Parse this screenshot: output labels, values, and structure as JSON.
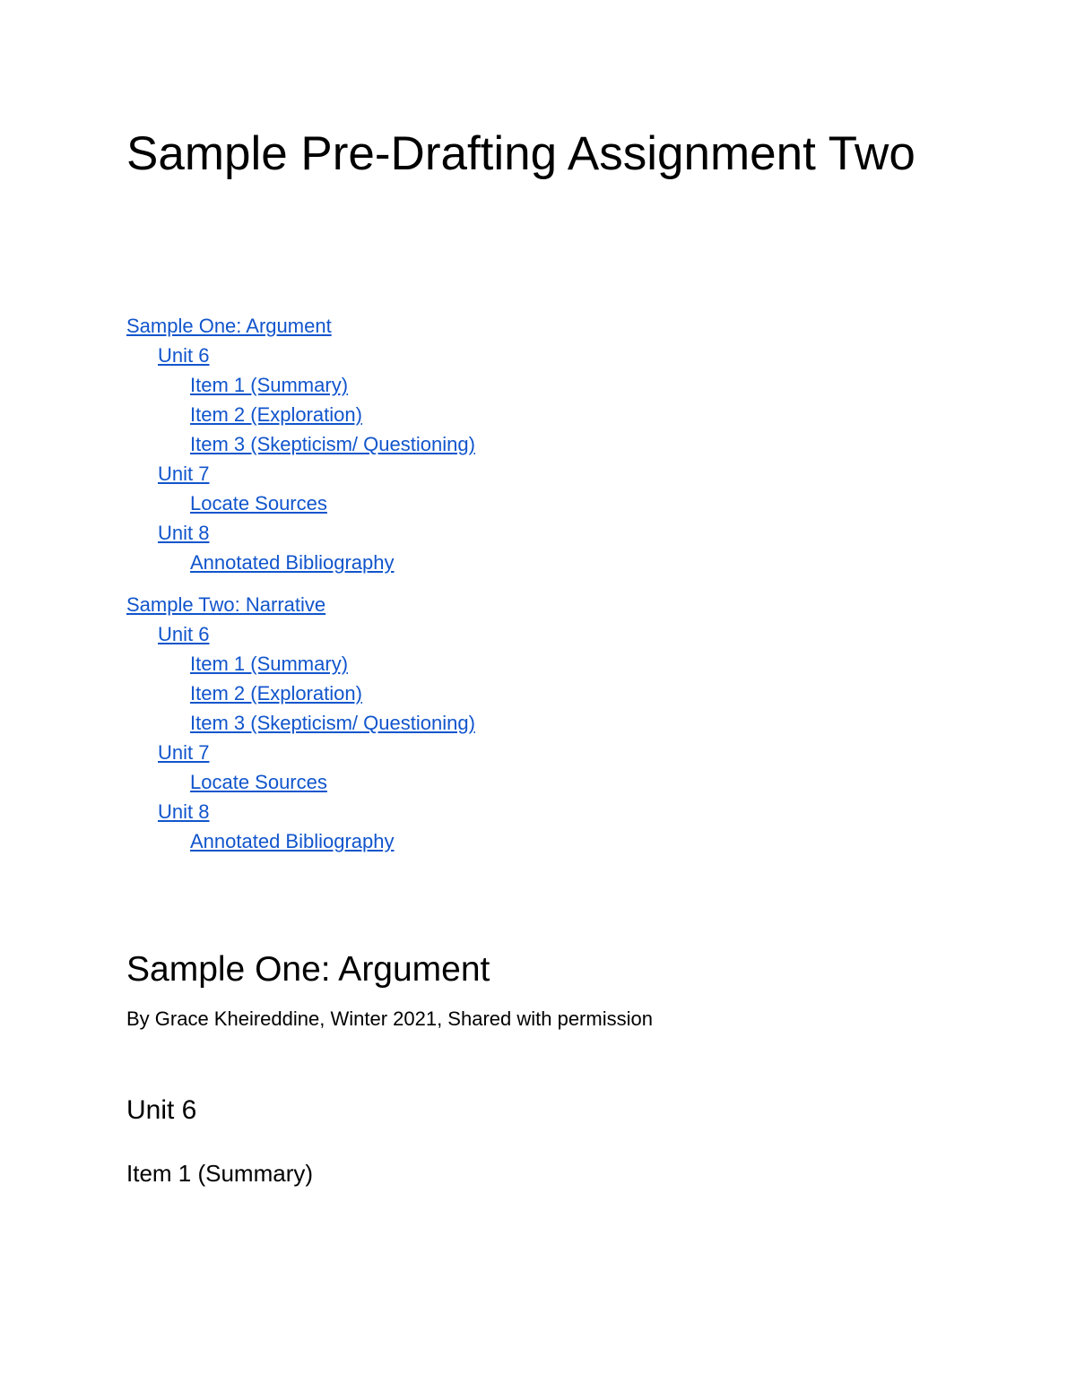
{
  "document": {
    "title": "Sample Pre-Drafting Assignment Two",
    "link_color": "#1155cc"
  },
  "toc": {
    "groups": [
      {
        "label": "Sample One: Argument",
        "units": [
          {
            "label": "Unit 6",
            "items": [
              "Item 1 (Summary)",
              "Item 2 (Exploration)",
              "Item 3 (Skepticism/ Questioning)"
            ]
          },
          {
            "label": "Unit 7",
            "items": [
              "Locate Sources"
            ]
          },
          {
            "label": "Unit 8",
            "items": [
              "Annotated Bibliography"
            ]
          }
        ]
      },
      {
        "label": "Sample Two: Narrative",
        "units": [
          {
            "label": "Unit 6",
            "items": [
              "Item 1 (Summary)",
              "Item 2 (Exploration)",
              "Item 3 (Skepticism/ Questioning)"
            ]
          },
          {
            "label": "Unit 7",
            "items": [
              "Locate Sources"
            ]
          },
          {
            "label": "Unit 8",
            "items": [
              "Annotated Bibliography"
            ]
          }
        ]
      }
    ]
  },
  "body": {
    "section_heading": "Sample One: Argument",
    "byline": "By Grace Kheireddine, Winter 2021, Shared with permission",
    "unit_heading": "Unit 6",
    "item_heading": "Item 1 (Summary)"
  }
}
